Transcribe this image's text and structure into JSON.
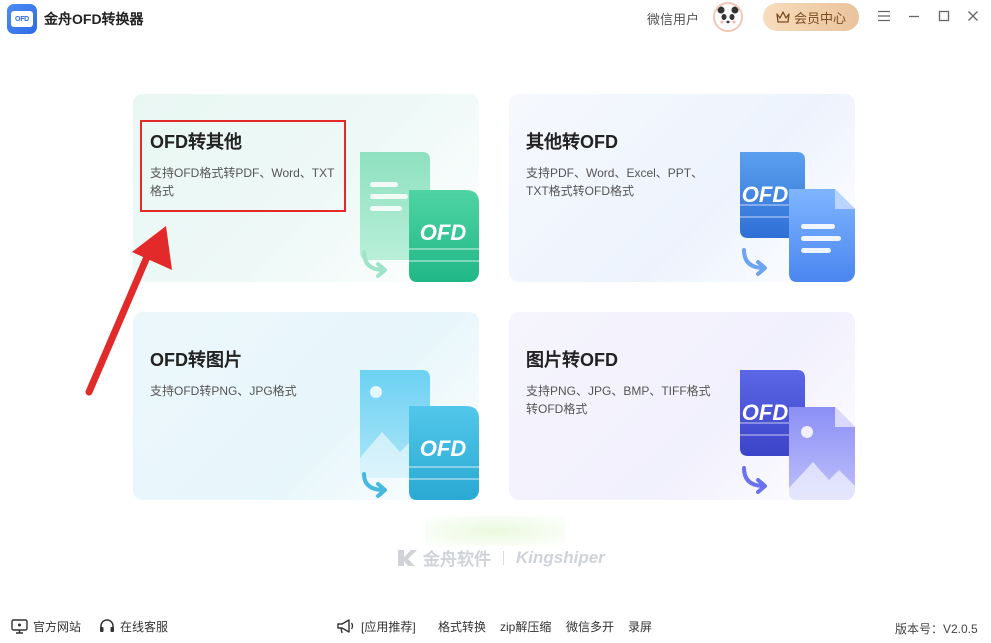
{
  "app": {
    "logo_text": "OFD",
    "title": "金舟OFD转换器"
  },
  "header": {
    "user_name": "微信用户",
    "vip_label": "会员中心"
  },
  "cards": [
    {
      "title": "OFD转其他",
      "desc": "支持OFD格式转PDF、Word、TXT格式",
      "badge": "OFD"
    },
    {
      "title": "其他转OFD",
      "desc": "支持PDF、Word、Excel、PPT、TXT格式转OFD格式",
      "badge": "OFD"
    },
    {
      "title": "OFD转图片",
      "desc": "支持OFD转PNG、JPG格式",
      "badge": "OFD"
    },
    {
      "title": "图片转OFD",
      "desc": "支持PNG、JPG、BMP、TIFF格式转OFD格式",
      "badge": "OFD"
    }
  ],
  "brand": {
    "cn": "金舟软件",
    "en": "Kingshiper"
  },
  "footer": {
    "website": "官方网站",
    "support": "在线客服",
    "recommend": "[应用推荐]",
    "links": [
      "格式转换",
      "zip解压缩",
      "微信多开",
      "录屏"
    ],
    "version": "版本号：V2.0.5"
  },
  "colors": {
    "highlight": "#e32a2a",
    "vip_bg": "#eac39b",
    "logo_blue": "#2f6ae6"
  }
}
